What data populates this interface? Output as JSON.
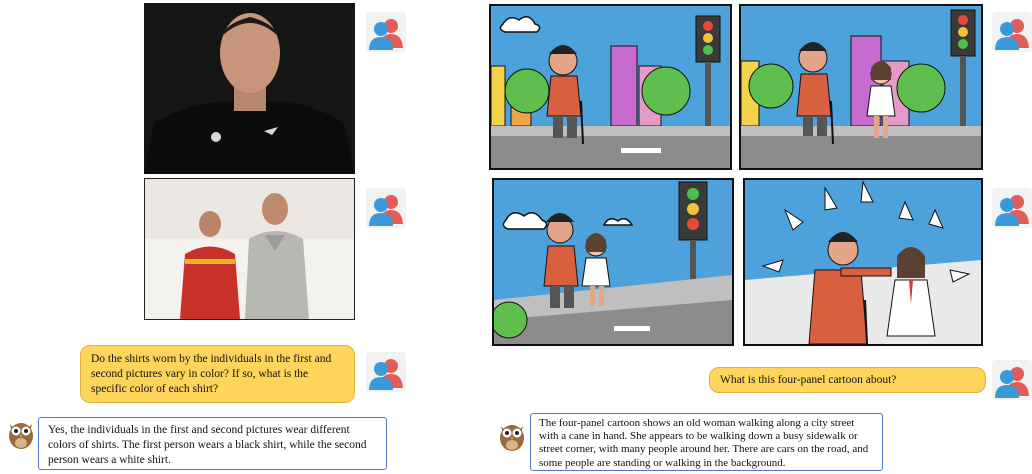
{
  "left_chat": {
    "user_question": "Do the shirts worn by the individuals in the first and second pictures vary in color? If so, what is the specific color of each shirt?",
    "bot_answer": "Yes, the individuals in the first and second pictures wear different colors of shirts. The first person wears a black shirt, while the second person wears a white shirt."
  },
  "right_chat": {
    "user_question": "What is this four-panel cartoon about?",
    "bot_answer": "The four-panel cartoon shows an old woman walking along a city street with a cane in hand. She appears to be walking down a busy sidewalk or street corner, with many people around her. There are cars on the road, and some people are standing or walking in the background."
  },
  "colors": {
    "user_bubble": "#ffd45a",
    "bot_bubble_border": "#4f79c7",
    "avatar_blue": "#3a9ad9",
    "avatar_red": "#e35b5b"
  },
  "icons": {
    "user_avatar": "user-pair-icon",
    "bot_avatar": "owl-icon"
  }
}
